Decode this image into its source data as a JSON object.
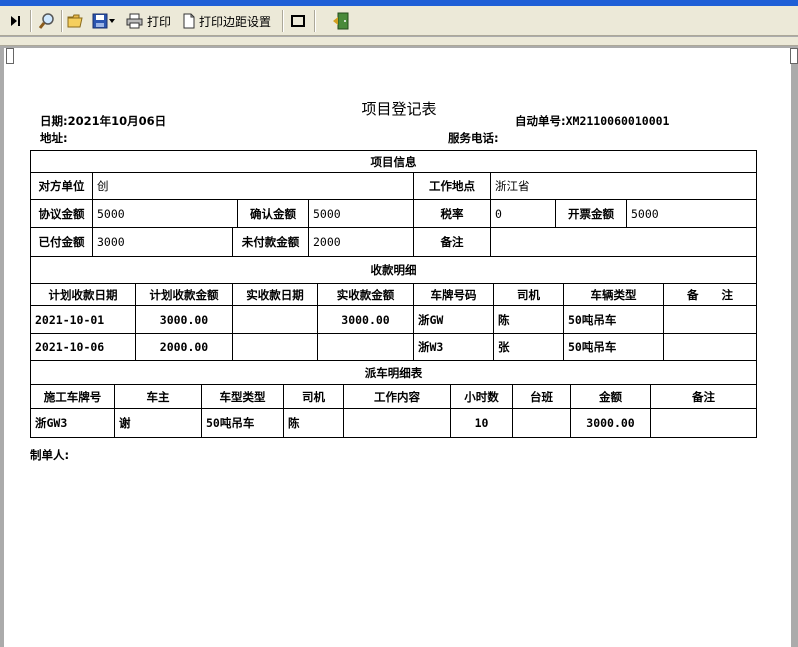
{
  "toolbar": {
    "print_label": "打印",
    "margin_label": "打印边距设置"
  },
  "document": {
    "title": "项目登记表",
    "date_label": "日期:",
    "date_value": "2021年10月06日",
    "auto_no_label": "自动单号:",
    "auto_no_value": "XM2110060010001",
    "address_label": "地址:",
    "phone_label": "服务电话:",
    "maker_label": "制单人:"
  },
  "project": {
    "section_title": "项目信息",
    "party_label": "对方单位",
    "party_value": "创",
    "location_label": "工作地点",
    "location_value": "浙江省",
    "agreed_label": "协议金额",
    "agreed_value": "5000",
    "confirmed_label": "确认金额",
    "confirmed_value": "5000",
    "tax_label": "税率",
    "tax_value": "0",
    "invoice_label": "开票金额",
    "invoice_value": "5000",
    "paid_label": "已付金额",
    "paid_value": "3000",
    "unpaid_label": "未付款金额",
    "unpaid_value": "2000",
    "remark_label": "备注",
    "remark_value": ""
  },
  "receipts": {
    "section_title": "收款明细",
    "columns": [
      "计划收款日期",
      "计划收款金额",
      "实收款日期",
      "实收款金额",
      "车牌号码",
      "司机",
      "车辆类型",
      "备　　注"
    ],
    "rows": [
      [
        "2021-10-01",
        "3000.00",
        "",
        "3000.00",
        "浙GW",
        "陈",
        "50吨吊车",
        ""
      ],
      [
        "2021-10-06",
        "2000.00",
        "",
        "",
        "浙W3",
        "张",
        "50吨吊车",
        ""
      ]
    ]
  },
  "dispatch": {
    "section_title": "派车明细表",
    "columns": [
      "施工车牌号",
      "车主",
      "车型类型",
      "司机",
      "工作内容",
      "小时数",
      "台班",
      "金额",
      "备注"
    ],
    "rows": [
      [
        "浙GW3",
        "谢",
        "50吨吊车",
        "陈",
        "",
        "10",
        "",
        "3000.00",
        ""
      ]
    ]
  }
}
